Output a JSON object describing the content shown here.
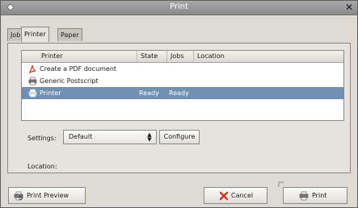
{
  "window": {
    "title": "Print",
    "close_symbol": "✕"
  },
  "tabs": [
    {
      "label": "Job",
      "active": false
    },
    {
      "label": "Printer",
      "active": true
    },
    {
      "label": "Paper",
      "active": false
    }
  ],
  "printer_list": {
    "columns": [
      "Printer",
      "State",
      "Jobs",
      "Location"
    ],
    "rows": [
      {
        "icon": "pdf-document-icon",
        "name": "Create a PDF document",
        "state": "",
        "jobs": "",
        "location": ""
      },
      {
        "icon": "printer-icon",
        "name": "Generic Postscript",
        "state": "",
        "jobs": "",
        "location": ""
      },
      {
        "icon": "printer-icon",
        "name": "Printer",
        "state": "Ready",
        "jobs": "Ready",
        "location": "",
        "selected": true
      }
    ]
  },
  "settings": {
    "label": "Settings:",
    "value": "Default",
    "configure_label": "Configure"
  },
  "location": {
    "label": "Location:"
  },
  "buttons": {
    "print_preview": "Print Preview",
    "cancel": "Cancel",
    "print": "Print"
  },
  "colors": {
    "selection": "#6f8fb3",
    "titlebar": "#9a9a9a",
    "cancel_icon": "#d03a1a",
    "pdf_icon": "#d03a1a"
  }
}
